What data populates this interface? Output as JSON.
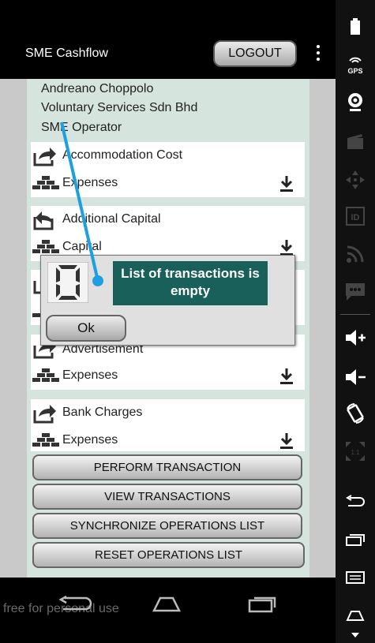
{
  "app": {
    "title": "SME Cashflow",
    "logout_label": "LOGOUT"
  },
  "user": {
    "name": "Andreano Choppolo",
    "company": "Voluntary Services Sdn Bhd",
    "role": "SME Operator"
  },
  "operations": [
    {
      "name": "Accommodation Cost",
      "category": "Expenses",
      "direction": "out"
    },
    {
      "name": "Additional Capital",
      "category": "Capital",
      "direction": "in"
    },
    {
      "name": "Advertisement",
      "category": "Expenses",
      "direction": "out"
    },
    {
      "name": "Bank Charges",
      "category": "Expenses",
      "direction": "out"
    }
  ],
  "buttons": {
    "perform": "PERFORM TRANSACTION",
    "view": "VIEW TRANSACTIONS",
    "sync": "SYNCHRONIZE OPERATIONS LIST",
    "reset": "RESET OPERATIONS LIST"
  },
  "dialog": {
    "message": "List of transactions is empty",
    "ok_label": "Ok",
    "icon": "digit-zero-icon"
  },
  "watermark": "free for personal use",
  "sidebar": {
    "gps_label": "GPS",
    "id_label": "ID",
    "scale_label": "1:1"
  },
  "colors": {
    "dialog_bg": "#195f5a",
    "content_bg": "#d6e4de",
    "pointer": "#1e9fe0"
  }
}
